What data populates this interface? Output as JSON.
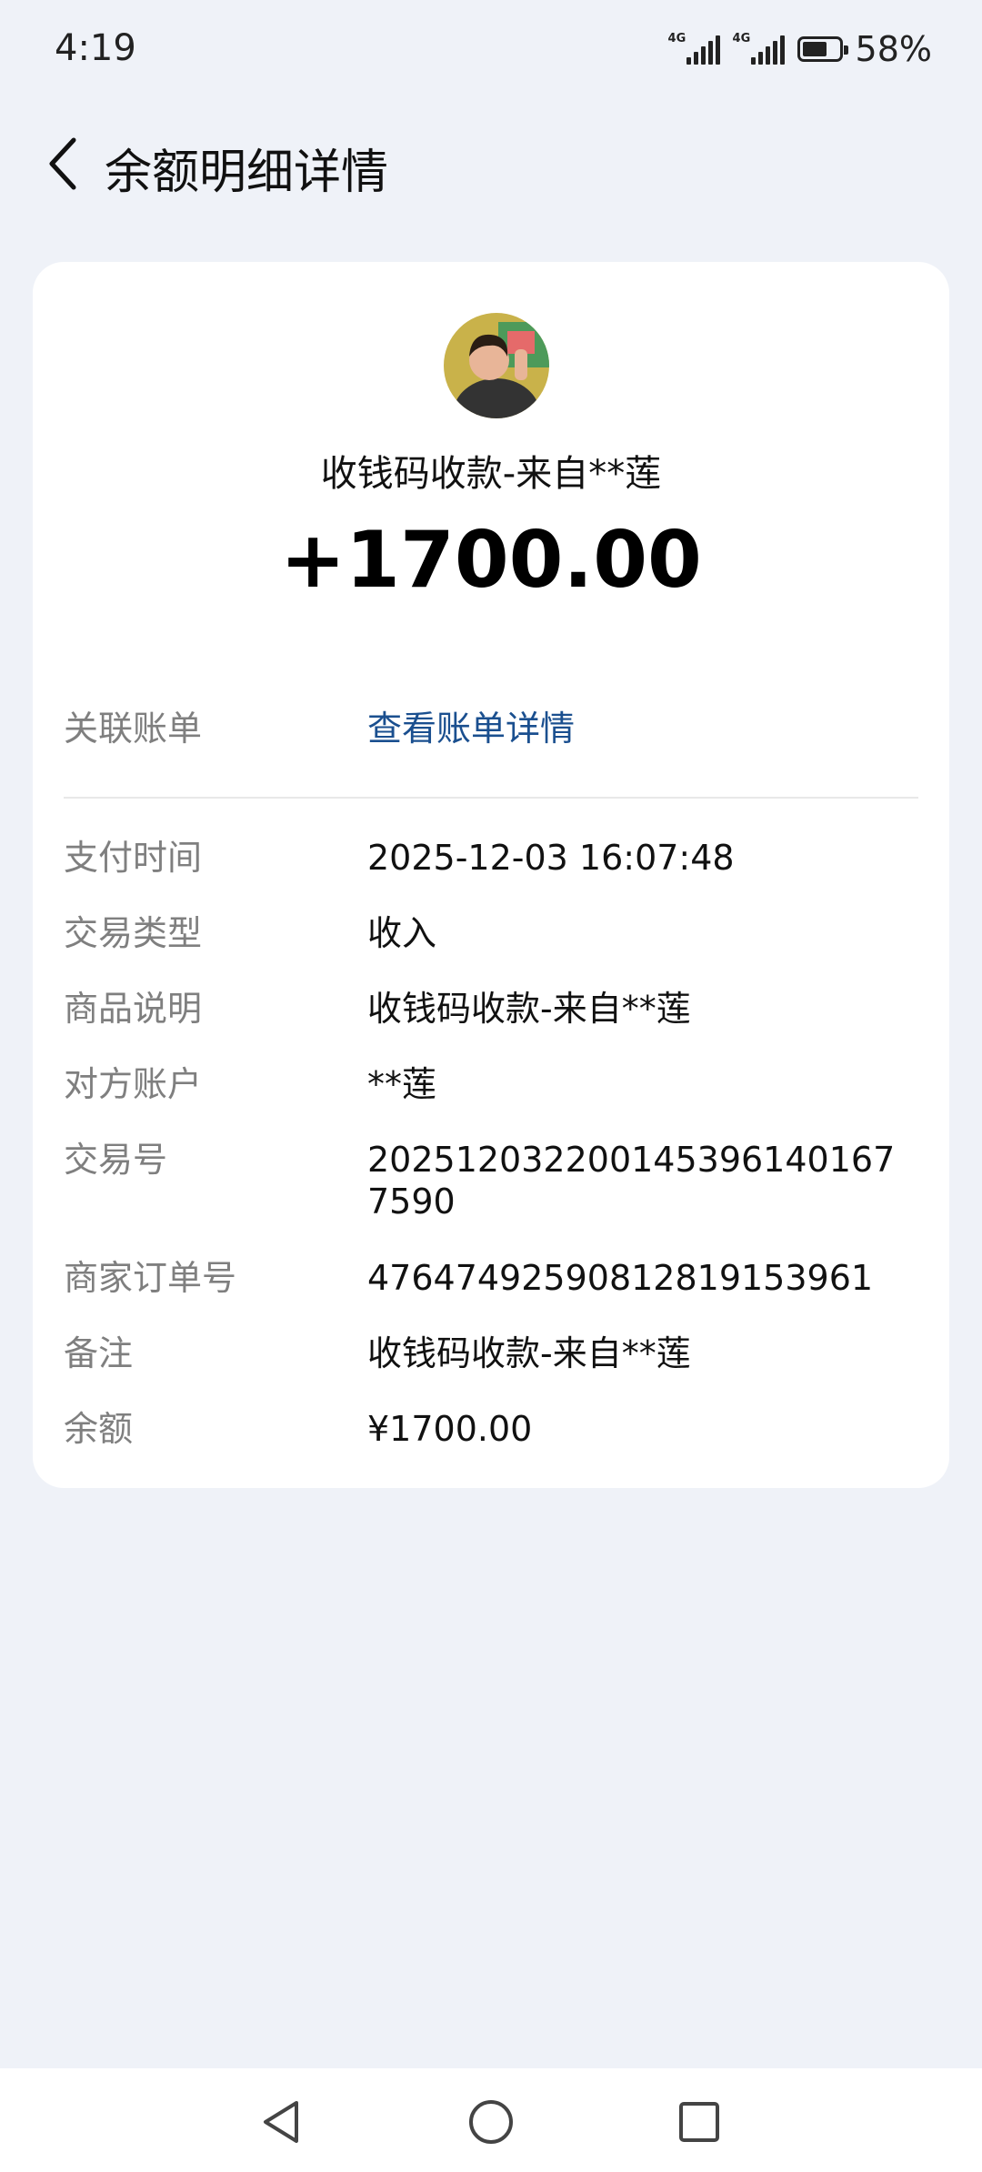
{
  "status": {
    "time": "4:19",
    "net1": "4G",
    "net2": "4G",
    "battery": "58%",
    "battery_level": 0.58
  },
  "header": {
    "title": "余额明细详情"
  },
  "transaction": {
    "title": "收钱码收款-来自**莲",
    "amount": "+1700.00"
  },
  "linked_bill": {
    "label": "关联账单",
    "link": "查看账单详情"
  },
  "details": [
    {
      "label": "支付时间",
      "value": "2025-12-03 16:07:48"
    },
    {
      "label": "交易类型",
      "value": "收入"
    },
    {
      "label": "商品说明",
      "value": "收钱码收款-来自**莲"
    },
    {
      "label": "对方账户",
      "value": "**莲"
    },
    {
      "label": "交易号",
      "value": "2025120322001453961401677590"
    },
    {
      "label": "商家订单号",
      "value": "4764749259081281915396​1"
    },
    {
      "label": "备注",
      "value": "收钱码收款-来自**莲"
    },
    {
      "label": "余额",
      "value": "¥1700.00"
    }
  ],
  "icons": {
    "back": "chevron-left-icon",
    "nav_back": "triangle-back-icon",
    "nav_home": "circle-home-icon",
    "nav_recent": "square-recent-icon"
  },
  "colors": {
    "link": "#1a4f8f",
    "background": "#eff2f8",
    "card": "#ffffff"
  }
}
